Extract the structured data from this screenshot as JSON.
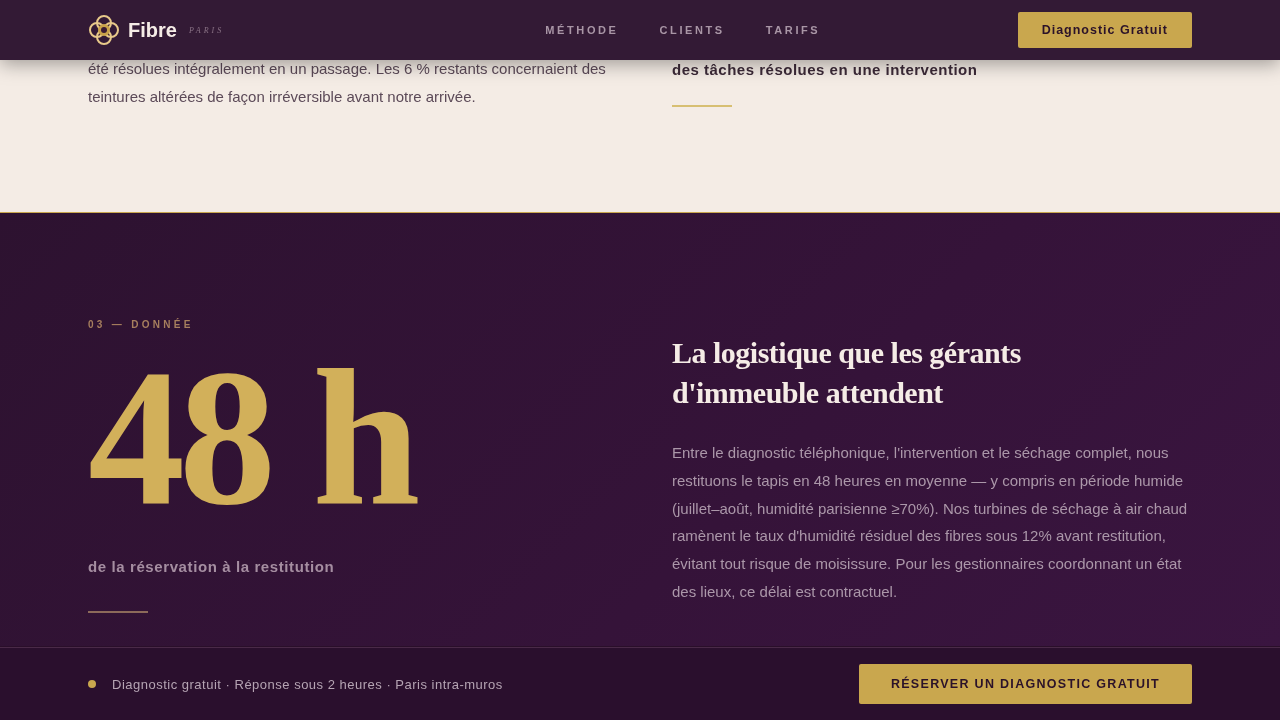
{
  "header": {
    "brand": "Fibre",
    "brand_sub": "PARIS",
    "nav": [
      {
        "label": "MÉTHODE"
      },
      {
        "label": "CLIENTS"
      },
      {
        "label": "TARIFS"
      }
    ],
    "cta": "Diagnostic Gratuit"
  },
  "previous_section": {
    "paragraph": "été résolues intégralement en un passage. Les 6 % restants concernaient des teintures altérées de façon irréversible avant notre arrivée.",
    "stat_caption": "des tâches résolues en une intervention"
  },
  "section": {
    "eyebrow": "03 — DONNÉE",
    "figure": "48 h",
    "figure_caption": "de la réservation à la restitution",
    "heading": "La logistique que les gérants d'immeuble attendent",
    "body": "Entre le diagnostic téléphonique, l'intervention et le séchage complet, nous restituons le tapis en 48 heures en moyenne — y compris en période humide (juillet–août, humidité parisienne ≥70%). Nos turbines de séchage à air chaud ramènent le taux d'humidité résiduel des fibres sous 12% avant restitution, évitant tout risque de moisissure. Pour les gestionnaires coordonnant un état des lieux, ce délai est contractuel."
  },
  "footer_bar": {
    "note": "Diagnostic gratuit · Réponse sous 2 heures · Paris intra-muros",
    "cta": "RÉSERVER UN DIAGNOSTIC GRATUIT"
  }
}
